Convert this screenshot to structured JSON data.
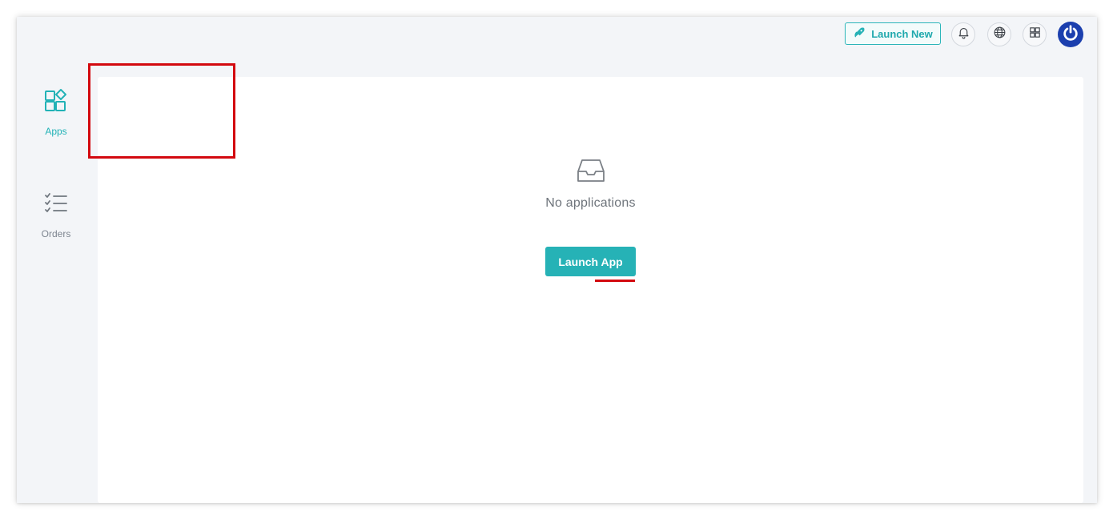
{
  "header": {
    "launch_new_label": "Launch New",
    "icons": [
      "rocket-icon",
      "bell-icon",
      "globe-icon",
      "apps-grid-icon",
      "power-icon"
    ]
  },
  "sidebar": {
    "items": [
      {
        "label": "Apps",
        "icon": "apps-icon",
        "active": true
      },
      {
        "label": "Orders",
        "icon": "orders-checklist-icon",
        "active": false
      }
    ]
  },
  "main": {
    "empty_state_text": "No applications",
    "launch_app_label": "Launch App",
    "empty_icon": "inbox-icon"
  },
  "colors": {
    "accent": "#26b2b6",
    "avatar": "#1b3fae",
    "annotation": "#d3090f",
    "background": "#f3f5f8"
  }
}
